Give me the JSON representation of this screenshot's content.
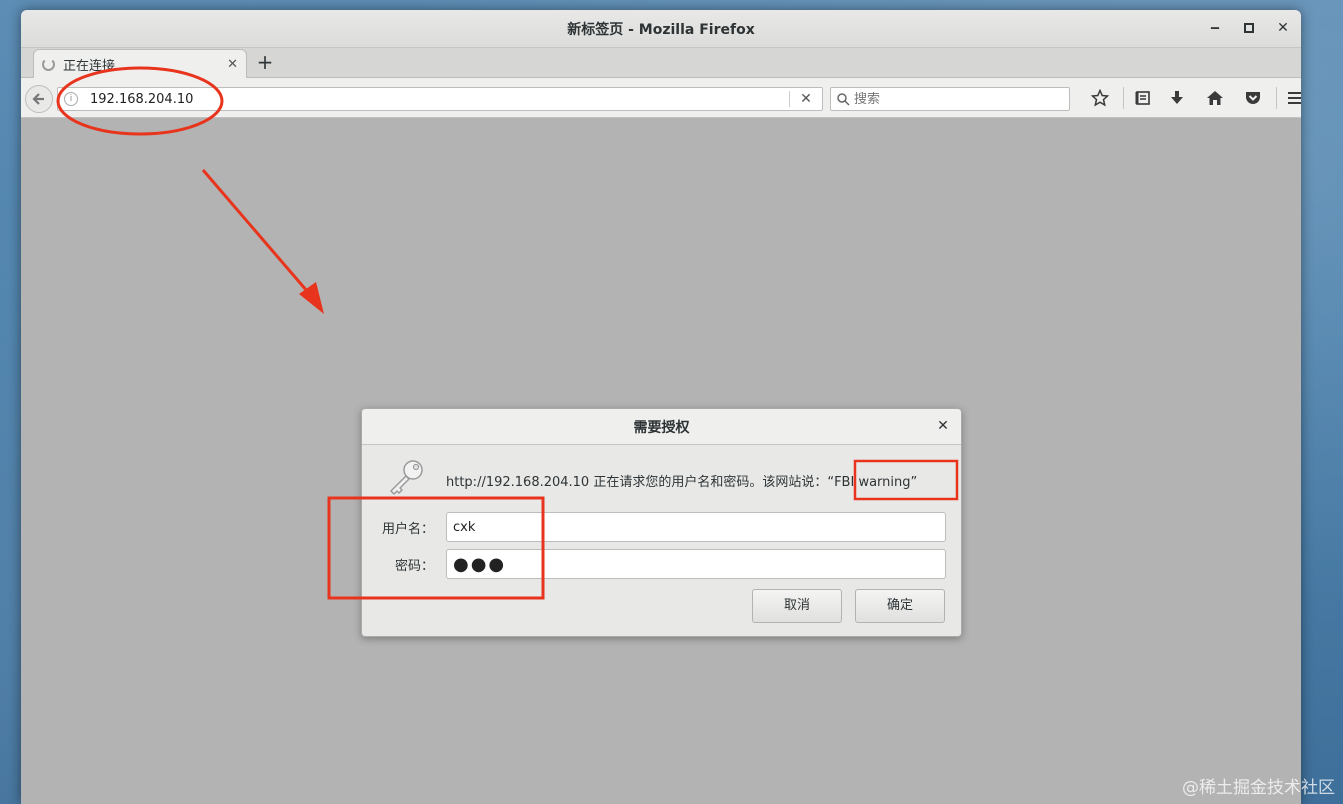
{
  "window": {
    "title": "新标签页 - Mozilla Firefox",
    "minimize": "‒",
    "maximize": "▫",
    "close": "✕"
  },
  "tab": {
    "label": "正在连接…",
    "close": "✕",
    "new_tab": "+"
  },
  "navbar": {
    "url": "192.168.204.10",
    "url_clear": "✕",
    "search_placeholder": "搜索"
  },
  "dialog": {
    "title": "需要授权",
    "close": "✕",
    "message": "http://192.168.204.10 正在请求您的用户名和密码。该网站说：",
    "realm": "“FBI warning”",
    "username_label": "用户名：",
    "username_value": "cxk",
    "password_label": "密码：",
    "password_value": "●●●",
    "cancel_label": "取消",
    "ok_label": "确定"
  },
  "annotation_color": "#e8341c",
  "watermark": "@稀土掘金技术社区"
}
